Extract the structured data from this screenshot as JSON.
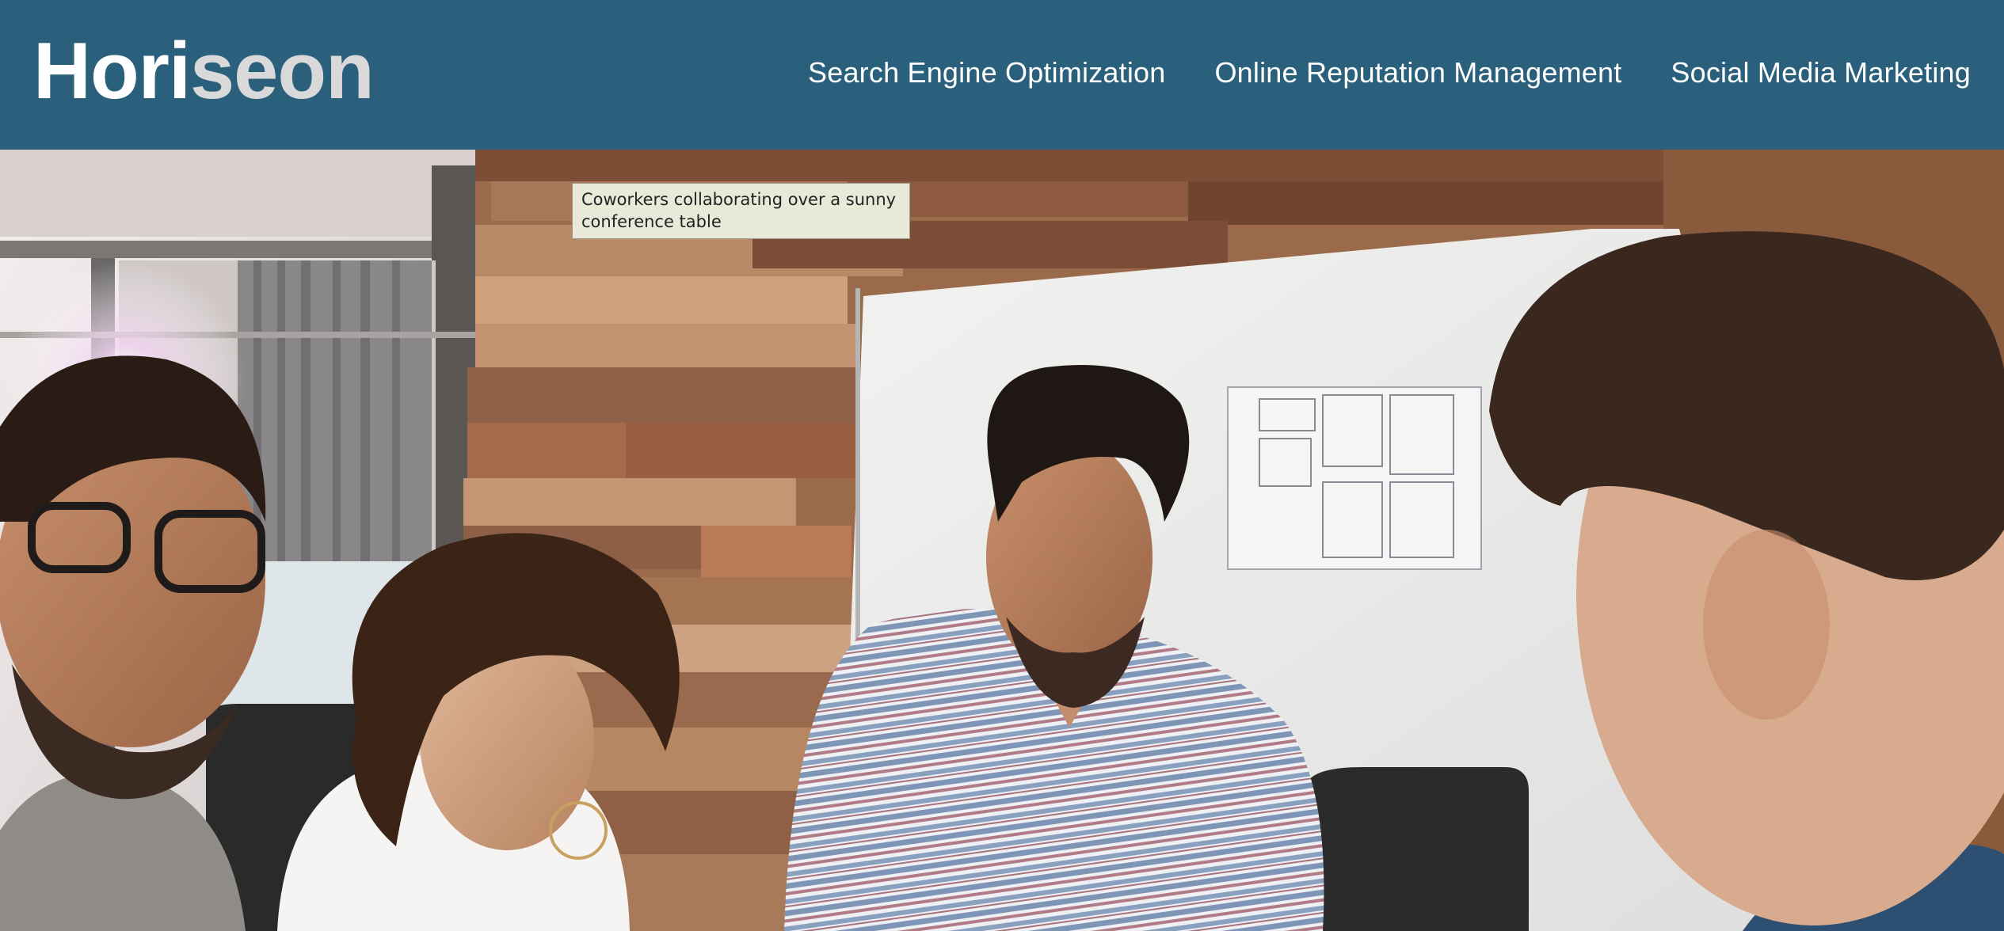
{
  "header": {
    "brand": {
      "part1": "Hori",
      "part2": "seon",
      "part2_color": "#d9d9d9"
    },
    "background_color": "#2a607c",
    "nav": [
      {
        "label": "Search Engine Optimization"
      },
      {
        "label": "Online Reputation Management"
      },
      {
        "label": "Social Media Marketing"
      }
    ]
  },
  "hero": {
    "image_alt": "Coworkers collaborating over a sunny conference table",
    "tooltip": "Coworkers collaborating over a sunny conference table"
  }
}
